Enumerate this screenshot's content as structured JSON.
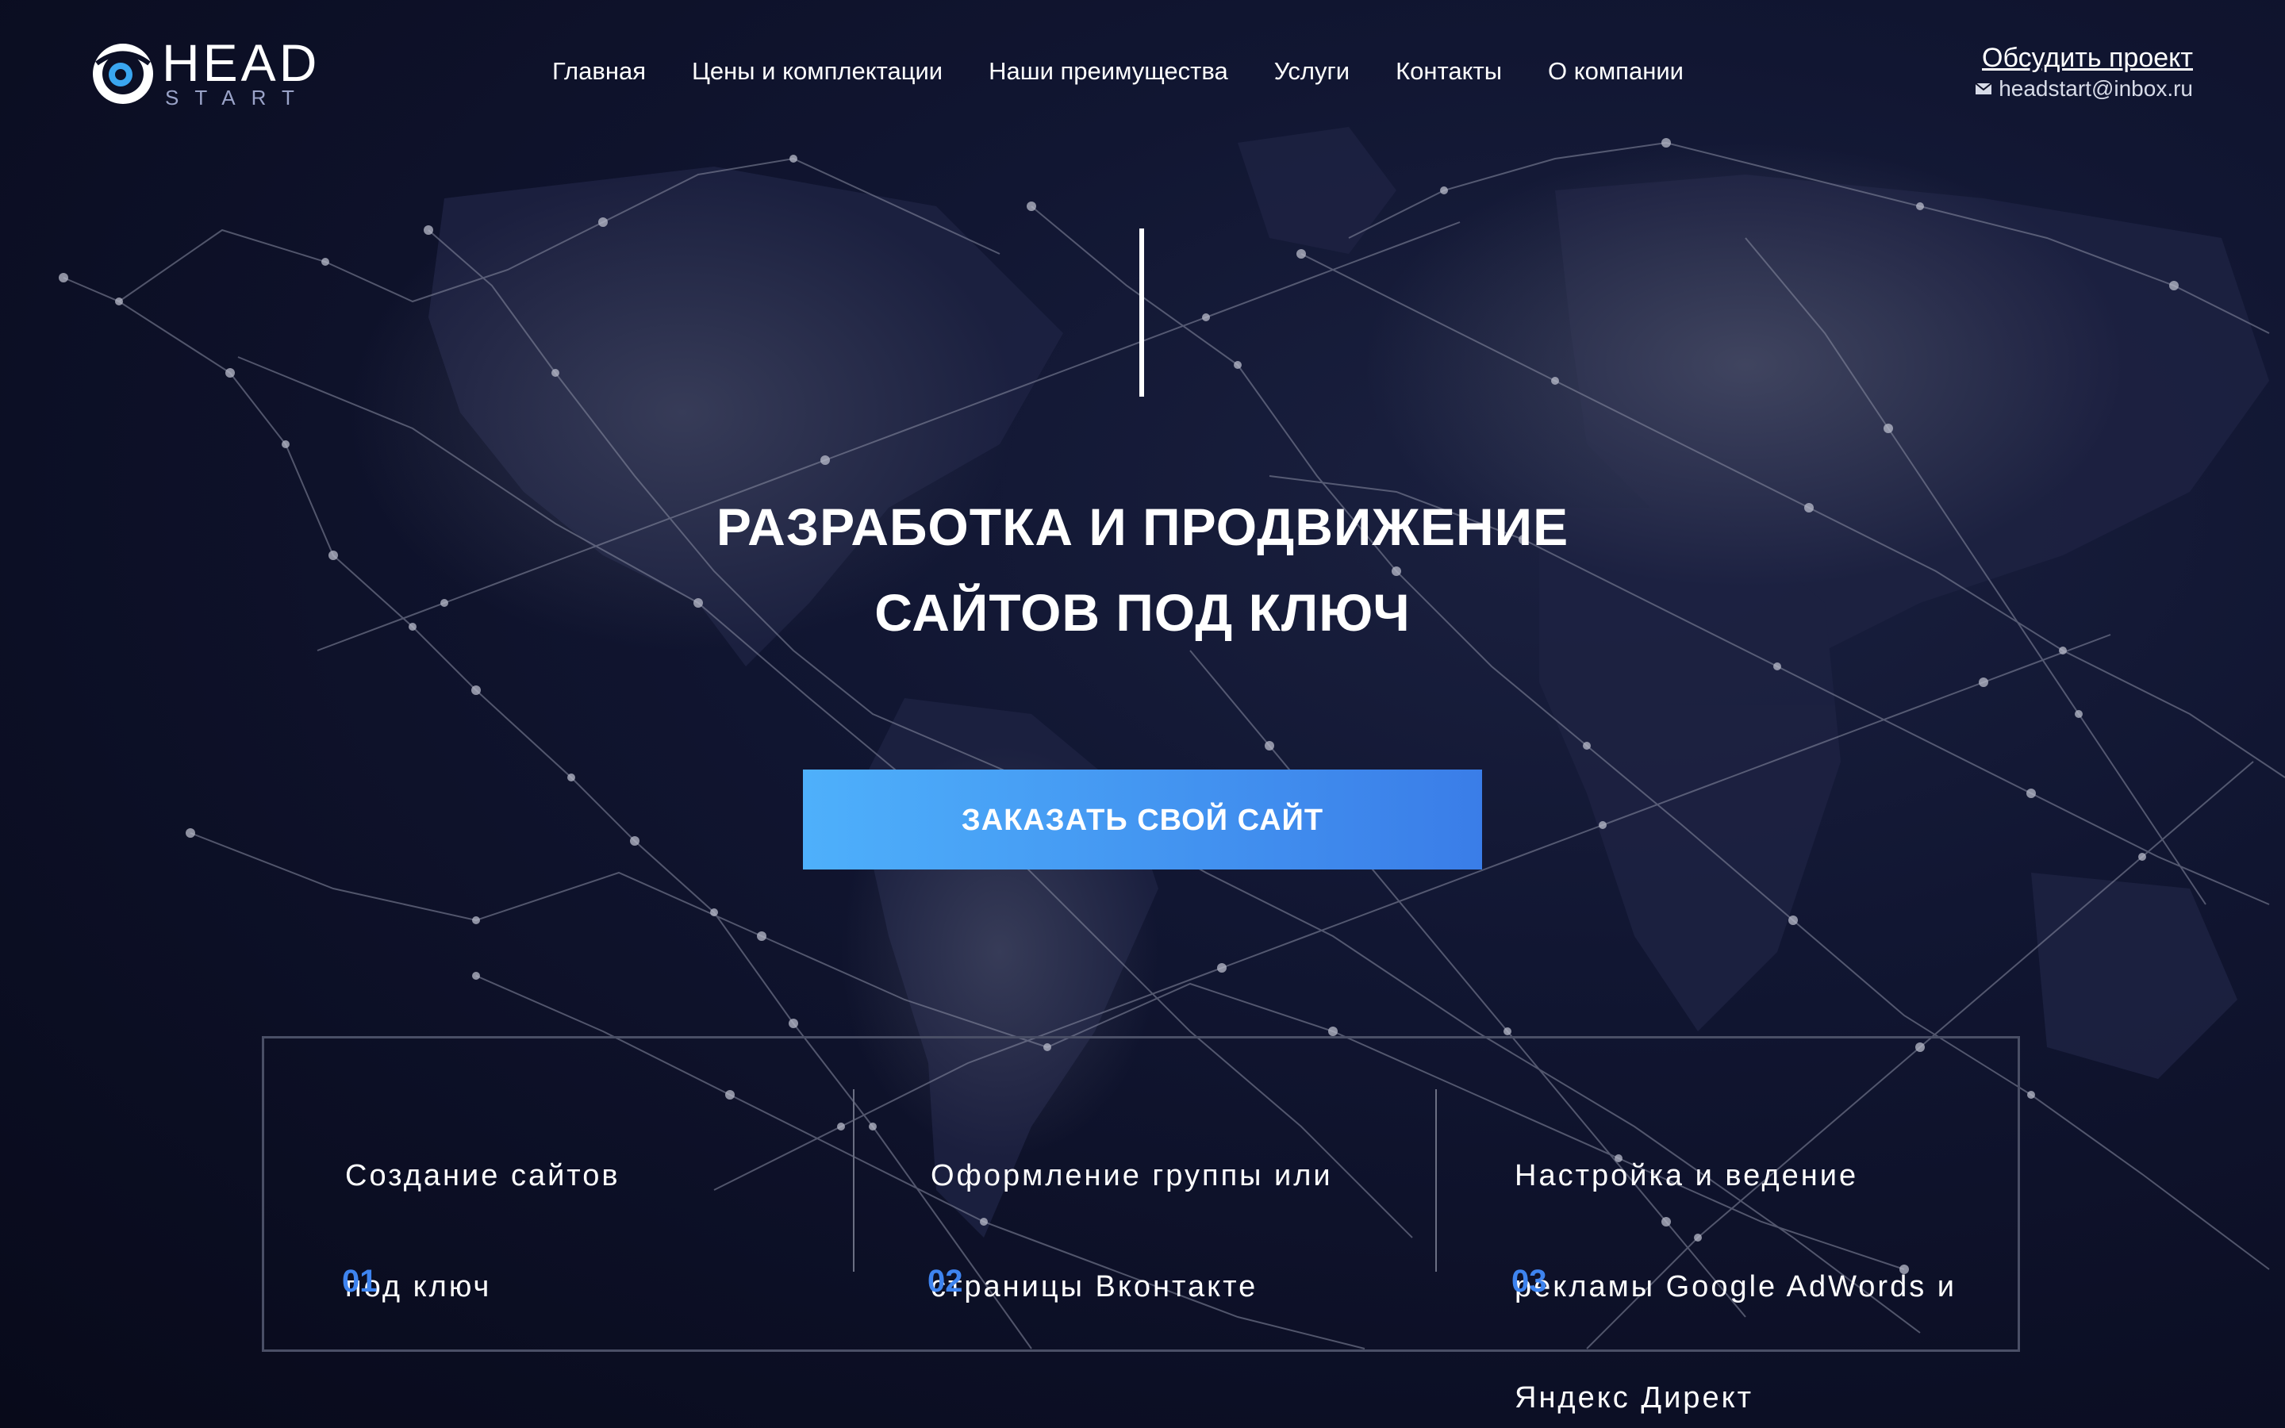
{
  "logo": {
    "word_main": "HEAD",
    "word_sub": "START"
  },
  "nav": {
    "items": [
      {
        "label": "Главная"
      },
      {
        "label": "Цены и комплектации"
      },
      {
        "label": "Наши преимущества"
      },
      {
        "label": "Услуги"
      },
      {
        "label": "Контакты"
      },
      {
        "label": "О компании"
      }
    ]
  },
  "contact": {
    "discuss_label": "Обсудить проект",
    "email": "headstart@inbox.ru",
    "email_icon": "envelope-icon"
  },
  "hero": {
    "title_line1": "РАЗРАБОТКА И ПРОДВИЖЕНИЕ",
    "title_line2": "САЙТОВ ПОД КЛЮЧ",
    "cta_label": "ЗАКАЗАТЬ СВОЙ САЙТ"
  },
  "services": [
    {
      "line1": "Создание сайтов",
      "line2": "под ключ",
      "line3": "",
      "number": "01"
    },
    {
      "line1": "Оформление группы или",
      "line2": "страницы Вконтакте",
      "line3": "",
      "number": "02"
    },
    {
      "line1": "Настройка и ведение",
      "line2": "рекламы Google AdWords и",
      "line3": "Яндекс Директ",
      "number": "03"
    }
  ],
  "colors": {
    "background": "#0c0f25",
    "accent": "#3e84f0",
    "cta_gradient_start": "#4eb0fb",
    "cta_gradient_end": "#3a7de8"
  }
}
